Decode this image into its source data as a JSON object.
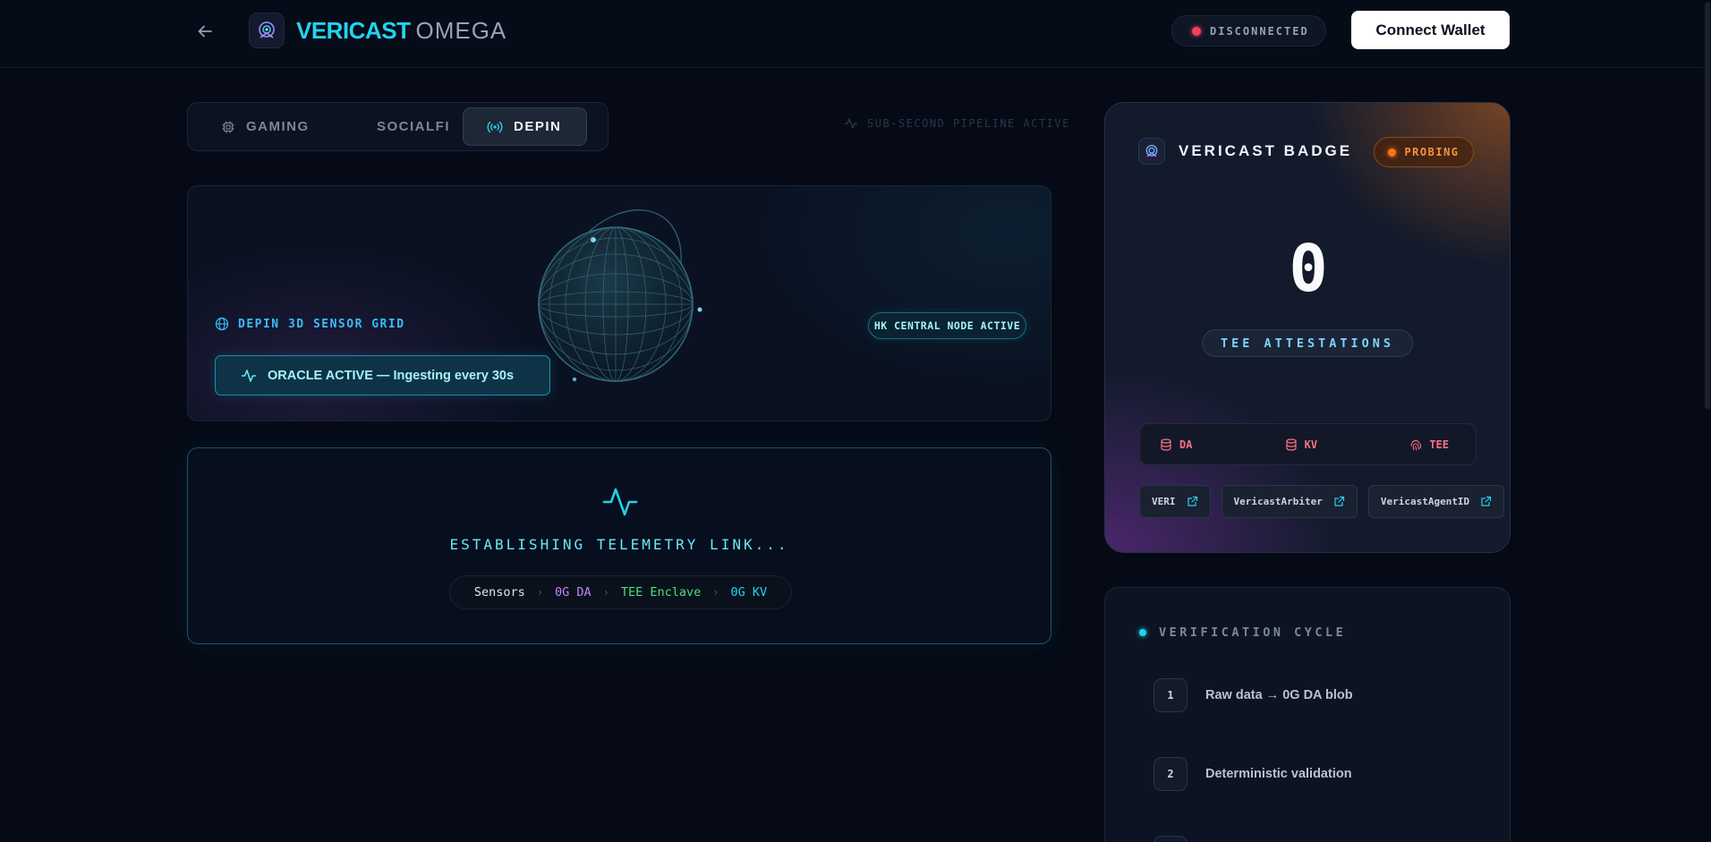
{
  "header": {
    "brand_primary": "VERICAST",
    "brand_secondary": "OMEGA",
    "status": "DISCONNECTED",
    "connect_label": "Connect Wallet"
  },
  "tabs": [
    {
      "label": "GAMING",
      "icon": "chip-icon",
      "active": false
    },
    {
      "label": "SOCIALFI",
      "icon": "network-icon",
      "active": false
    },
    {
      "label": "DEPIN",
      "icon": "broadcast-icon",
      "active": true
    }
  ],
  "pipeline_status": "SUB-SECOND PIPELINE ACTIVE",
  "sensor_grid": {
    "label": "DEPIN 3D SENSOR GRID",
    "oracle_label": "ORACLE ACTIVE — Ingesting every 30s",
    "node_badge": "HK CENTRAL NODE ACTIVE"
  },
  "telemetry": {
    "title": "ESTABLISHING TELEMETRY LINK...",
    "pipeline": [
      "Sensors",
      "0G DA",
      "TEE Enclave",
      "0G KV"
    ]
  },
  "badge": {
    "title": "VERICAST BADGE",
    "status": "PROBING",
    "count": "0",
    "count_label": "TEE ATTESTATIONS",
    "storage": [
      "DA",
      "KV",
      "TEE"
    ],
    "contracts": [
      "VERI",
      "VericastArbiter",
      "VericastAgentID"
    ]
  },
  "cycle": {
    "title": "VERIFICATION CYCLE",
    "steps": [
      {
        "num": "1",
        "text": "Raw data → 0G DA blob"
      },
      {
        "num": "2",
        "text": "Deterministic validation"
      }
    ]
  },
  "colors": {
    "accent": "#22d3ee",
    "danger": "#f43f5e",
    "warning": "#f97316",
    "background": "#050a16"
  }
}
